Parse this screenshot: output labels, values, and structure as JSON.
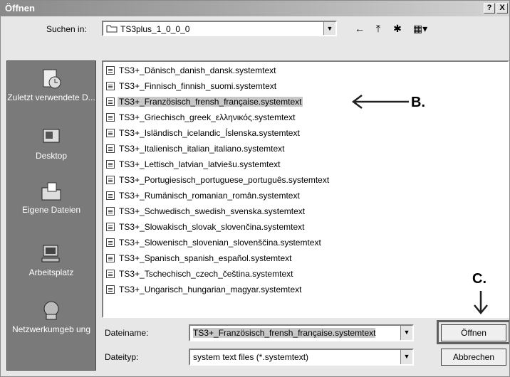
{
  "window": {
    "title": "Öffnen",
    "help_label": "?",
    "close_label": "X"
  },
  "toolbar": {
    "look_in_label": "Suchen in:",
    "look_in_value": "TS3plus_1_0_0_0",
    "back_icon": "←",
    "up_icon": "⤒",
    "new_folder_icon": "✱",
    "views_icon": "▦▾"
  },
  "places": [
    {
      "label": "Zuletzt verwendete D...",
      "icon": "recent-documents-icon"
    },
    {
      "label": "Desktop",
      "icon": "desktop-icon"
    },
    {
      "label": "Eigene Dateien",
      "icon": "my-documents-icon"
    },
    {
      "label": "Arbeitsplatz",
      "icon": "my-computer-icon"
    },
    {
      "label": "Netzwerkumgeb ung",
      "icon": "network-icon"
    }
  ],
  "files": [
    {
      "name": "TS3+_Dänisch_danish_dansk.systemtext"
    },
    {
      "name": "TS3+_Finnisch_finnish_suomi.systemtext"
    },
    {
      "name": "TS3+_Französisch_frensh_française.systemtext",
      "selected": true
    },
    {
      "name": "TS3+_Griechisch_greek_ελληνικός.systemtext"
    },
    {
      "name": "TS3+_Isländisch_icelandic_Íslenska.systemtext"
    },
    {
      "name": "TS3+_Italienisch_italian_italiano.systemtext"
    },
    {
      "name": "TS3+_Lettisch_latvian_latviešu.systemtext"
    },
    {
      "name": "TS3+_Portugiesisch_portuguese_português.systemtext"
    },
    {
      "name": "TS3+_Rumänisch_romanian_român.systemtext"
    },
    {
      "name": "TS3+_Schwedisch_swedish_svenska.systemtext"
    },
    {
      "name": "TS3+_Slowakisch_slovak_slovenčina.systemtext"
    },
    {
      "name": "TS3+_Slowenisch_slovenian_slovenščina.systemtext"
    },
    {
      "name": "TS3+_Spanisch_spanish_español.systemtext"
    },
    {
      "name": "TS3+_Tschechisch_czech_čeština.systemtext"
    },
    {
      "name": "TS3+_Ungarisch_hungarian_magyar.systemtext"
    }
  ],
  "bottom": {
    "filename_label": "Dateiname:",
    "filename_value": "TS3+_Französisch_frensh_française.systemtext",
    "filetype_label": "Dateityp:",
    "filetype_value": "system text files (*.systemtext)",
    "open_button": "Öffnen",
    "cancel_button": "Abbrechen"
  },
  "annotations": {
    "b_label": "B.",
    "c_label": "C."
  }
}
